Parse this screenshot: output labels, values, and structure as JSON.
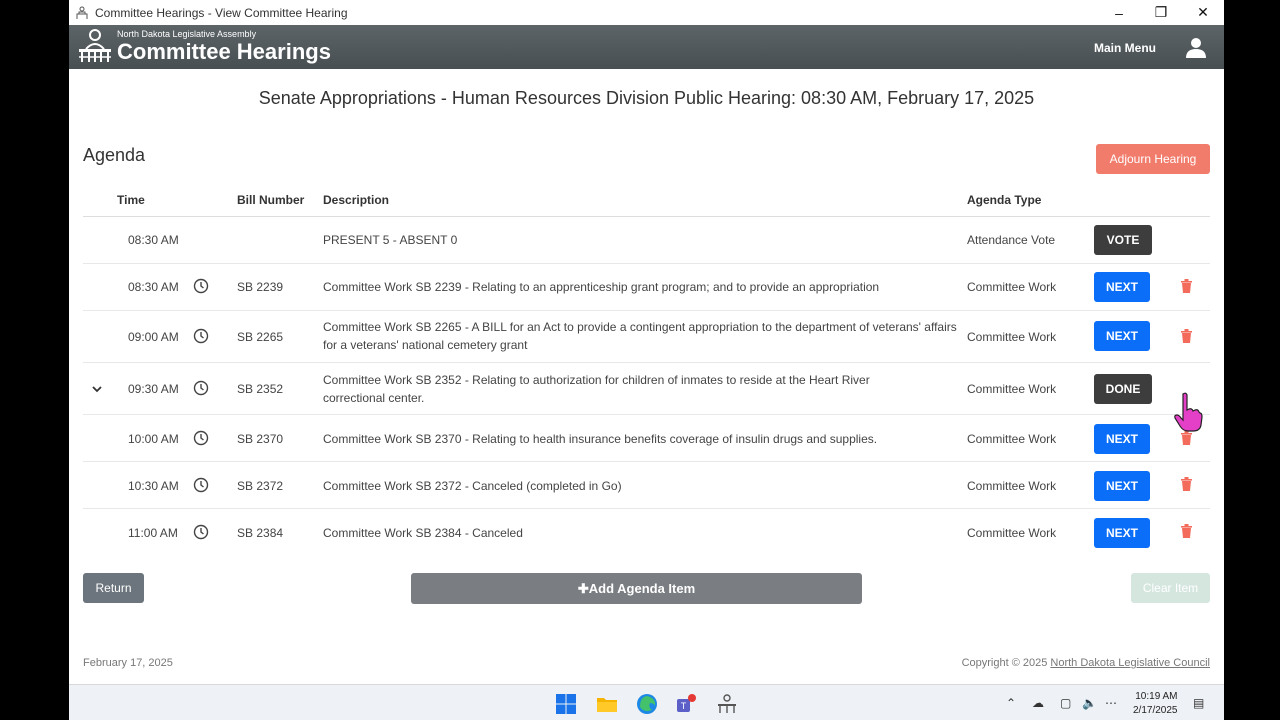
{
  "window": {
    "title": "Committee Hearings - View Committee Hearing"
  },
  "header": {
    "subtitle": "North Dakota Legislative Assembly",
    "title": "Committee Hearings",
    "main_menu": "Main Menu"
  },
  "hearing": {
    "title": "Senate Appropriations - Human Resources Division Public Hearing: 08:30 AM, February 17, 2025"
  },
  "agenda": {
    "label": "Agenda",
    "adjourn_label": "Adjourn Hearing",
    "columns": {
      "time": "Time",
      "bill": "Bill Number",
      "description": "Description",
      "type": "Agenda Type"
    },
    "rows": [
      {
        "time": "08:30 AM",
        "bill": "",
        "description": "PRESENT 5 - ABSENT 0",
        "type": "Attendance Vote",
        "action": "VOTE"
      },
      {
        "time": "08:30 AM",
        "bill": "SB 2239",
        "description": "Committee Work SB 2239 - Relating to an apprenticeship grant program; and to provide an appropriation",
        "type": "Committee Work",
        "action": "NEXT"
      },
      {
        "time": "09:00 AM",
        "bill": "SB 2265",
        "description": "Committee Work SB 2265 - A BILL for an Act to provide a contingent appropriation to the department of veterans' affairs for a veterans' national cemetery grant",
        "type": "Committee Work",
        "action": "NEXT"
      },
      {
        "time": "09:30 AM",
        "bill": "SB 2352",
        "description": "Committee Work SB 2352 - Relating to authorization for children of inmates to reside at the Heart River correctional center.",
        "type": "Committee Work",
        "action": "DONE"
      },
      {
        "time": "10:00 AM",
        "bill": "SB 2370",
        "description": "Committee Work SB 2370 - Relating to health insurance benefits coverage of insulin drugs and supplies.",
        "type": "Committee Work",
        "action": "NEXT"
      },
      {
        "time": "10:30 AM",
        "bill": "SB 2372",
        "description": "Committee Work SB 2372 - Canceled (completed in Go)",
        "type": "Committee Work",
        "action": "NEXT"
      },
      {
        "time": "11:00 AM",
        "bill": "SB 2384",
        "description": "Committee Work SB 2384 - Canceled",
        "type": "Committee Work",
        "action": "NEXT"
      }
    ]
  },
  "actions": {
    "return": "Return",
    "add": "Add Agenda Item",
    "clear": "Clear Item"
  },
  "footer": {
    "date": "February 17, 2025",
    "copyright": "Copyright © 2025",
    "council": "North Dakota Legislative Council"
  },
  "taskbar": {
    "time": "10:19 AM",
    "date": "2/17/2025"
  },
  "colors": {
    "appbar": "#4f575a",
    "next": "#0b6ef8",
    "adjourn": "#f27c6c",
    "trash": "#f26b5b"
  }
}
